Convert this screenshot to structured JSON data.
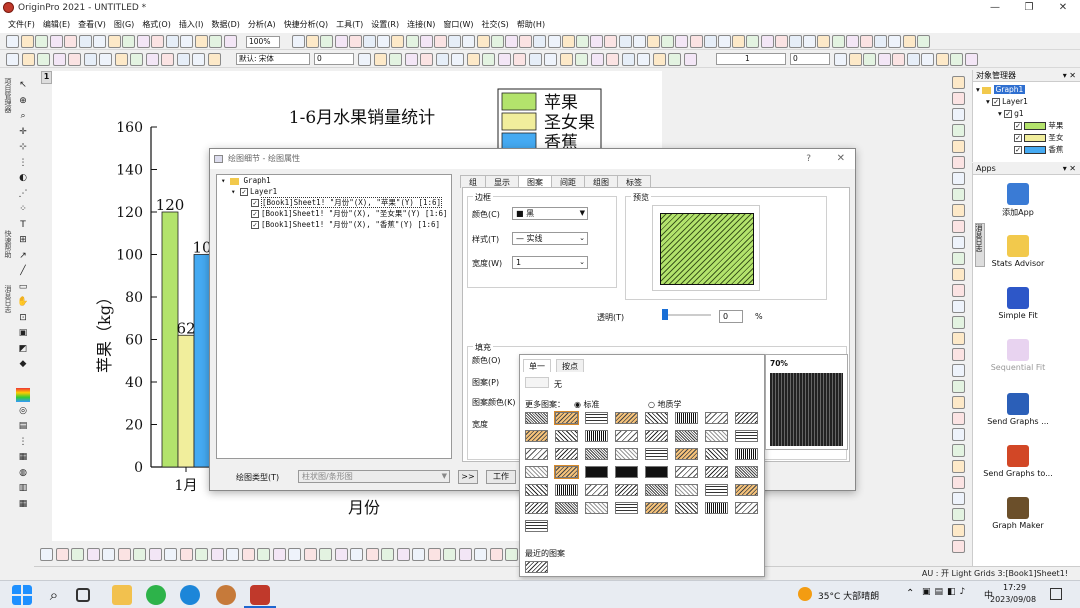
{
  "window": {
    "title": "OriginPro 2021 - UNTITLED *"
  },
  "menu": [
    "文件(F)",
    "编辑(E)",
    "查看(V)",
    "图(G)",
    "格式(O)",
    "插入(I)",
    "数据(D)",
    "分析(A)",
    "快捷分析(Q)",
    "工具(T)",
    "设置(R)",
    "连接(N)",
    "窗口(W)",
    "社交(S)",
    "帮助(H)"
  ],
  "toolbar": {
    "zoom": "100%",
    "font": "默认: 宋体",
    "font_size": "0",
    "width": "1",
    "angle": "0"
  },
  "graph": {
    "page_tab": "1"
  },
  "chart_data": {
    "type": "bar",
    "title": "1-6月水果销量统计",
    "xlabel": "月份",
    "ylabel": "苹果（kg）",
    "ylim": [
      0,
      160
    ],
    "yticks": [
      "0",
      "20",
      "40",
      "60",
      "80",
      "100",
      "120",
      "140",
      "160"
    ],
    "categories": [
      "1月"
    ],
    "series": [
      {
        "name": "苹果",
        "values": [
          120
        ],
        "color": "#b3e36c"
      },
      {
        "name": "圣女果",
        "values": [
          62
        ],
        "color": "#f1ee9c"
      },
      {
        "name": "香蕉",
        "values": [
          100
        ],
        "color": "#45aaf2"
      }
    ],
    "data_labels": [
      "120",
      "62",
      "10"
    ]
  },
  "object_manager": {
    "header": "对象管理器",
    "tree": [
      "Graph1",
      "Layer1",
      "g1",
      "苹果",
      "圣女",
      "香蕉"
    ]
  },
  "apps": {
    "header": "Apps",
    "items": [
      "添加App",
      "Stats Advisor",
      "Simple Fit",
      "Sequential Fit",
      "Send Graphs ...",
      "Send Graphs to...",
      "Graph Maker"
    ]
  },
  "dialog": {
    "title": "绘图细节 - 绘图属性",
    "help": "?",
    "tree": [
      "Graph1",
      "Layer1",
      "[Book1]Sheet1! \"月份\"(X), \"苹果\"(Y) [1:6]",
      "[Book1]Sheet1! \"月份\"(X), \"圣女果\"(Y) [1:6]",
      "[Book1]Sheet1! \"月份\"(X), \"香蕉\"(Y) [1:6]"
    ],
    "tabs": [
      "组",
      "显示",
      "图案",
      "间距",
      "组图",
      "标签"
    ],
    "border": {
      "label": "边框",
      "color_label": "颜色(C)",
      "color_value": "黑",
      "style_label": "样式(T)",
      "style_value": "实线",
      "width_label": "宽度(W)",
      "width_value": "1"
    },
    "preview_label": "预览",
    "transparency_label": "透明(T)",
    "transparency_value": "0",
    "transparency_unit": "%",
    "fill": {
      "label": "填充",
      "color_label": "颜色(O)",
      "pattern_label": "图案(P)",
      "pattern_color_label": "图案颜色(K)",
      "width_label": "宽度"
    },
    "plot_type_label": "绘图类型(T)",
    "plot_type_value": "柱状图/条形图",
    "work_button": "工作",
    "arrow_button": ">>"
  },
  "pattern_popup": {
    "tab_single": "单一",
    "tab_index": "按点",
    "none_label": "无",
    "more_label": "更多图案：",
    "opt_standard": "标准",
    "opt_geology": "地质学",
    "recent_label": "最近的图案",
    "preview_value": "70%"
  },
  "statusbar": {
    "text": "AU : 开  Light Grids 3:[Book1]Sheet1!"
  },
  "taskbar": {
    "weather": "35°C 大部晴朗",
    "time": "17:29",
    "date": "2023/09/08",
    "ime": "中"
  }
}
